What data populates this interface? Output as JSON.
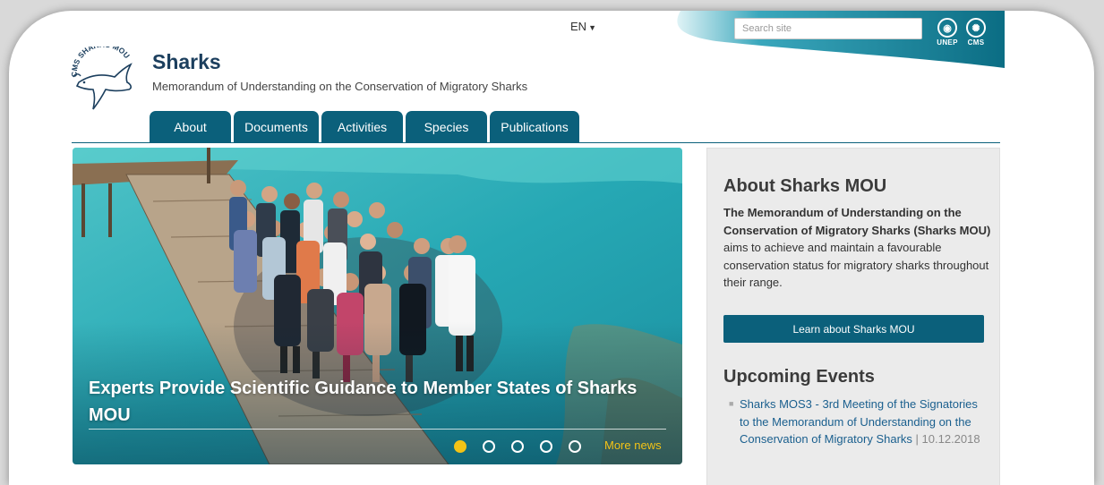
{
  "header": {
    "language": "EN",
    "search_placeholder": "Search site",
    "logo_text": "CMS SHARKS MOU",
    "partner_logos": [
      {
        "label": "UNEP",
        "icon": "unep-logo-icon"
      },
      {
        "label": "CMS",
        "icon": "cms-logo-icon"
      }
    ]
  },
  "site": {
    "title": "Sharks",
    "subtitle": "Memorandum of Understanding on the Conservation of Migratory Sharks"
  },
  "nav": {
    "items": [
      {
        "label": "About"
      },
      {
        "label": "Documents"
      },
      {
        "label": "Activities"
      },
      {
        "label": "Species"
      },
      {
        "label": "Publications"
      }
    ]
  },
  "hero": {
    "title": "Experts Provide Scientific Guidance to Member States of Sharks MOU",
    "slide_count": 5,
    "active_slide": 1,
    "more_label": "More news"
  },
  "about": {
    "title": "About Sharks MOU",
    "text_bold": "The Memorandum of Understanding on the Conservation of Migratory Sharks (Sharks MOU)",
    "text_rest": " aims to achieve and maintain a favourable conservation status for migratory sharks throughout their range.",
    "button_label": "Learn about Sharks MOU"
  },
  "events": {
    "title": "Upcoming Events",
    "items": [
      {
        "title": "Sharks MOS3 - 3rd Meeting of the Signatories to the Memorandum of Understanding on the Conservation of Migratory Sharks",
        "date": "10.12.2018"
      }
    ]
  },
  "colors": {
    "primary": "#0b607b",
    "accent": "#f3c316",
    "link": "#1a5f8e",
    "title": "#1c3f5e"
  }
}
